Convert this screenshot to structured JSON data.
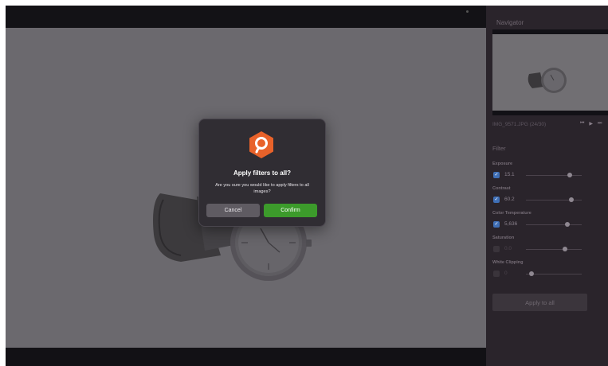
{
  "navigator": {
    "title": "Navigator",
    "file_info": "IMG_9571.JPG (24/30)",
    "controls": [
      "⏮",
      "▶",
      "⏭"
    ]
  },
  "filter": {
    "title": "Filter",
    "items": [
      {
        "label": "Exposure",
        "value": "15.1",
        "checked": true,
        "level": 0.78
      },
      {
        "label": "Contrast",
        "value": "60.2",
        "checked": true,
        "level": 0.82
      },
      {
        "label": "Color Temperature",
        "value": "5,636",
        "checked": true,
        "level": 0.74
      },
      {
        "label": "Saturation",
        "value": "0.0",
        "checked": false,
        "level": 0.7
      },
      {
        "label": "White Clipping",
        "value": "0",
        "checked": false,
        "level": 0.1
      }
    ],
    "apply_all_label": "Apply to all"
  },
  "dialog": {
    "title": "Apply filters to all?",
    "message": "Are you sure you would like to apply filters to all images?",
    "cancel_label": "Cancel",
    "confirm_label": "Confirm"
  },
  "colors": {
    "accent_confirm": "#3c9b2b",
    "logo_orange": "#e8622a",
    "checkbox_blue": "#3f6fb6"
  }
}
